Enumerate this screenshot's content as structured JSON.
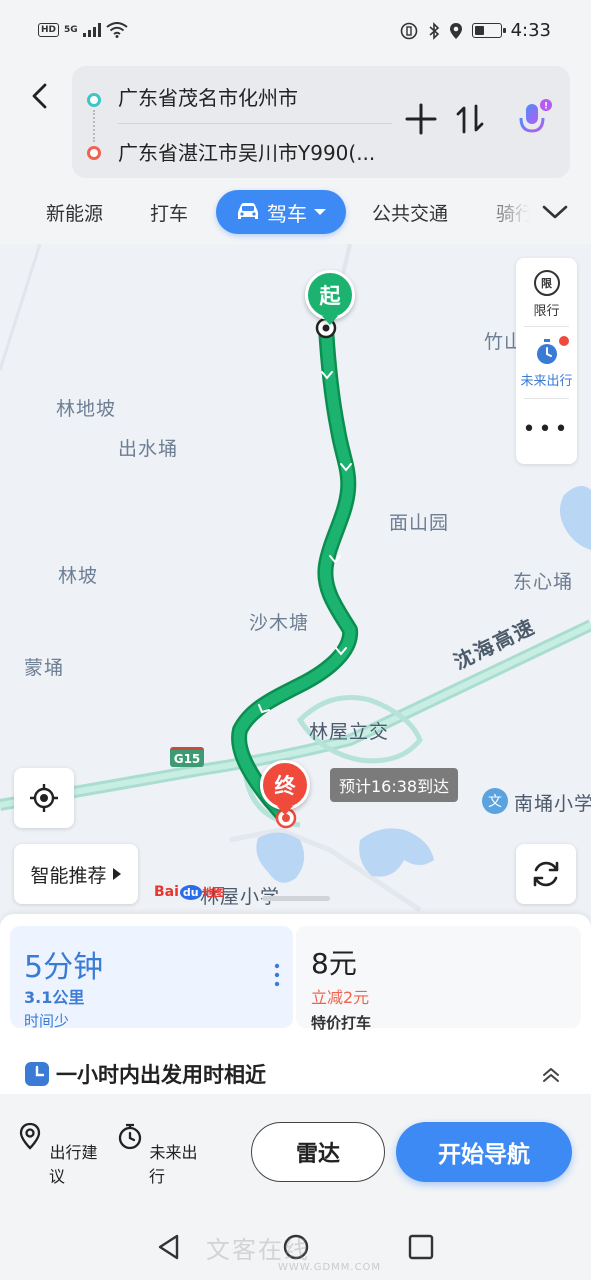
{
  "status_bar": {
    "hd_label": "HD",
    "signal_label": "5G",
    "time": "4:33",
    "battery_level_percent": 40
  },
  "header": {
    "origin": "广东省茂名市化州市",
    "destination": "广东省湛江市吴川市Y990(...",
    "icons": {
      "back": "back-arrow-icon",
      "add": "plus-icon",
      "swap": "swap-icon",
      "voice": "microphone-icon"
    }
  },
  "mode_tabs": {
    "items": [
      {
        "label": "新能源"
      },
      {
        "label": "打车"
      },
      {
        "label": "驾车",
        "active": true
      },
      {
        "label": "公共交通"
      },
      {
        "label": "骑行"
      }
    ],
    "accent_color": "#3d8af5"
  },
  "map": {
    "start_marker": "起",
    "end_marker": "终",
    "eta": "预计16:38到达",
    "highway_name": "沈海高速",
    "highway_code": "G15",
    "places": [
      "竹山",
      "林地坡",
      "出水埇",
      "面山园",
      "林坡",
      "东心埇",
      "沙木塘",
      "蒙埇",
      "林屋立交",
      "南埇小学",
      "林屋小学"
    ],
    "school_icon": "文",
    "side_panel": {
      "limit_label": "限行",
      "limit_icon_text": "限",
      "future_label": "未来出行"
    },
    "smart_recommend": "智能推荐",
    "logo": {
      "baidu": "Bai",
      "du": "du",
      "map": "地图"
    },
    "route_color": "#1bb36f"
  },
  "route_card": {
    "time": "5分钟",
    "distance": "3.1公里",
    "tag": "时间少"
  },
  "taxi_card": {
    "price": "8元",
    "discount": "立减2元",
    "tag": "特价打车"
  },
  "tip": {
    "text": "一小时内出发用时相近"
  },
  "action_bar": {
    "advice_label": "出行建议",
    "future_label": "未来出行",
    "radar_label": "雷达",
    "navigate_label": "开始导航"
  },
  "system_nav": {
    "watermark": "文客在线",
    "watermark_url": "WWW.GDMM.COM"
  }
}
